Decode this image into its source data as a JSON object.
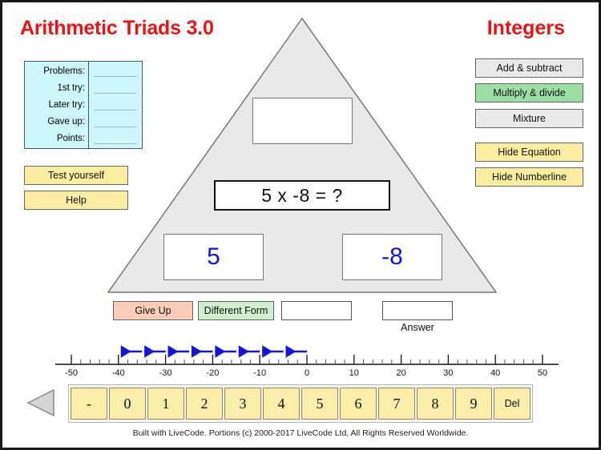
{
  "app": {
    "title_left": "Arithmetic Triads 3.0",
    "title_right": "Integers",
    "title_color": "#ee1111"
  },
  "stats": {
    "rows": [
      {
        "label": "Problems:",
        "value": ""
      },
      {
        "label": "1st try:",
        "value": ""
      },
      {
        "label": "Later try:",
        "value": ""
      },
      {
        "label": "Gave up:",
        "value": ""
      },
      {
        "label": "Points:",
        "value": ""
      }
    ],
    "background": "#ccf7fb"
  },
  "left_buttons": {
    "test_yourself": "Test yourself",
    "help": "Help"
  },
  "mode_buttons": {
    "add_subtract": "Add & subtract",
    "multiply_divide": "Multiply & divide",
    "mixture": "Mixture",
    "selected": "Multiply & divide",
    "selected_color": "#9ae0a5",
    "unselected_color": "#e9e9e9"
  },
  "toggle_buttons": {
    "hide_equation": "Hide Equation",
    "hide_numberline": "Hide Numberline",
    "color": "#fcee9e"
  },
  "triangle": {
    "fill": "#e9e9e9",
    "stroke": "#777777",
    "result_box_value": "",
    "equation": "5 x -8 = ?",
    "operand_left": "5",
    "operand_right": "-8",
    "operand_color": "#1414e0"
  },
  "action_row": {
    "give_up": "Give Up",
    "give_up_color": "#fbcdb8",
    "different_form": "Different Form",
    "different_form_color": "#cdf0cd",
    "work_value": "",
    "answer_value": "",
    "answer_label": "Answer"
  },
  "numberline": {
    "min": -50,
    "max": 50,
    "major_step": 10,
    "minor_step": 2,
    "tick_labels": [
      "-50",
      "-40",
      "-30",
      "-20",
      "-10",
      "0",
      "10",
      "20",
      "30",
      "40",
      "50"
    ],
    "arrow_color": "#1414e0",
    "arrows": [
      {
        "from": 0,
        "to": -5
      },
      {
        "from": -5,
        "to": -10
      },
      {
        "from": -10,
        "to": -15
      },
      {
        "from": -15,
        "to": -20
      },
      {
        "from": -20,
        "to": -25
      },
      {
        "from": -25,
        "to": -30
      },
      {
        "from": -30,
        "to": -35
      },
      {
        "from": -35,
        "to": -40
      }
    ]
  },
  "keypad": {
    "keys": [
      "-",
      "0",
      "1",
      "2",
      "3",
      "4",
      "5",
      "6",
      "7",
      "8",
      "9",
      "Del"
    ],
    "key_color": "#fbeeaa",
    "prev_arrow_icon": "triangle-left-icon"
  },
  "footer": {
    "text": "Built with LiveCode. Portions (c) 2000-2017 LiveCode Ltd, All Rights Reserved Worldwide."
  }
}
